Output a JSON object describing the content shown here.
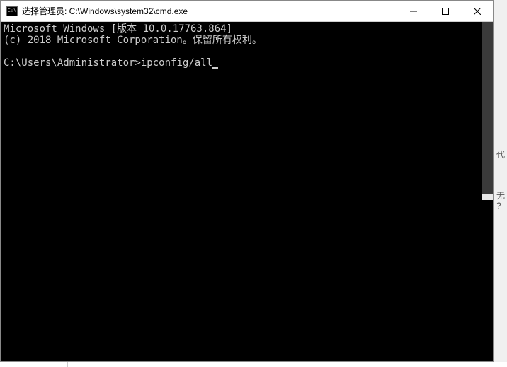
{
  "titlebar": {
    "icon_text": "C:\\",
    "title": "选择管理员: C:\\Windows\\system32\\cmd.exe"
  },
  "terminal": {
    "line1": "Microsoft Windows [版本 10.0.17763.864]",
    "line2": "(c) 2018 Microsoft Corporation。保留所有权利。",
    "prompt": "C:\\Users\\Administrator>",
    "command": "ipconfig/all"
  },
  "background": {
    "char1": "代",
    "char2": "无",
    "char3": "?"
  }
}
